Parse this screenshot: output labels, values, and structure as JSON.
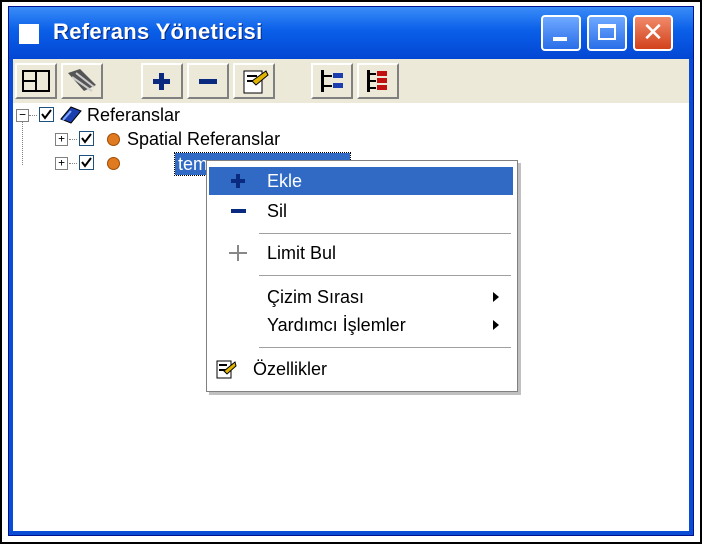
{
  "window": {
    "title": "Referans Yöneticisi",
    "colors": {
      "titlebar": "#0a5fe8",
      "selection": "#316ac5",
      "close": "#d2421c"
    }
  },
  "toolbar": {
    "items": [
      {
        "name": "view-icon",
        "symbol": ""
      },
      {
        "name": "layers-icon",
        "symbol": ""
      },
      {
        "name": "add-icon",
        "symbol": "+"
      },
      {
        "name": "remove-icon",
        "symbol": "−"
      },
      {
        "name": "properties-icon",
        "symbol": ""
      },
      {
        "name": "tree-expand-icon",
        "symbol": ""
      },
      {
        "name": "tree-collapse-icon",
        "symbol": ""
      }
    ]
  },
  "tree": {
    "root": {
      "label": "Referanslar",
      "checked": true
    },
    "children": [
      {
        "label": "Spatial Referanslar",
        "checked": true
      },
      {
        "label": "tem",
        "checked": true,
        "selected": true
      }
    ]
  },
  "context_menu": {
    "items": [
      {
        "label": "Ekle",
        "icon": "plus-icon",
        "highlighted": true
      },
      {
        "label": "Sil",
        "icon": "minus-icon"
      },
      {
        "label": "Limit Bul",
        "icon": "crosshair-icon"
      },
      {
        "label": "Çizim Sırası",
        "submenu": true
      },
      {
        "label": "Yardımcı İşlemler",
        "submenu": true
      },
      {
        "label": "Özellikler",
        "icon": "properties-icon"
      }
    ]
  }
}
